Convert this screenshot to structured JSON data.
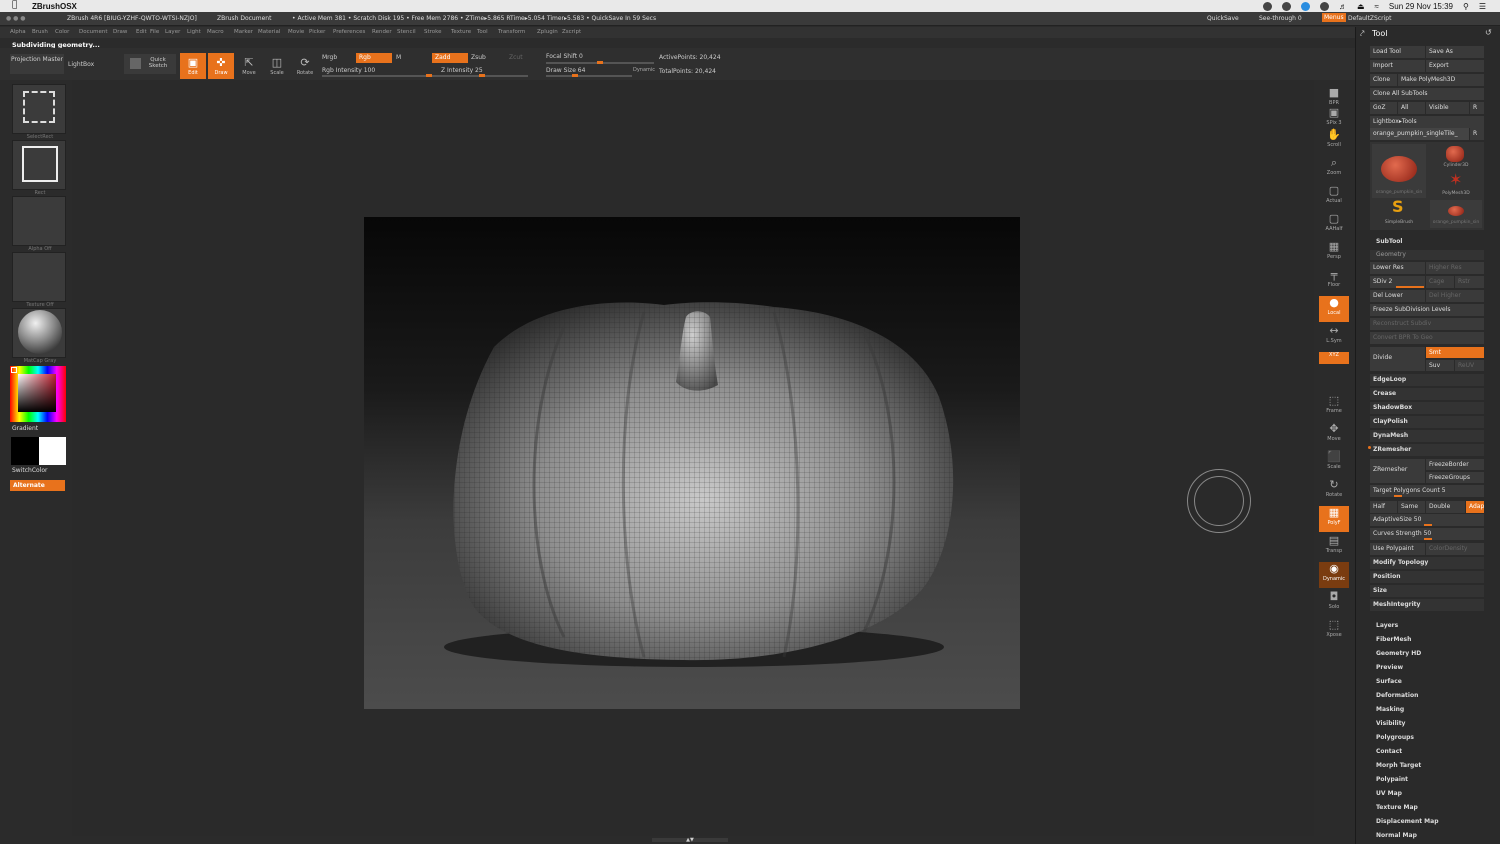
{
  "macos": {
    "app_name": "ZBrushOSX",
    "datetime": "Sun 29 Nov  15:39"
  },
  "titlebar": {
    "app_version": "ZBrush 4R6 [BIUG-YZHF-QWTO-WTSI-NZJO]",
    "doc_title": "ZBrush Document",
    "mem_info": "• Active Mem 381 • Scratch Disk 195 • Free Mem 2786 • ZTime▸5.865 RTime▸5.054 Timer▸5.583 • QuickSave In 59 Secs",
    "quicksave": "QuickSave",
    "seethrough": "See-through  0",
    "menus": "Menus",
    "defaultscript": "DefaultZScript"
  },
  "menubar": [
    "Alpha",
    "Brush",
    "Color",
    "Document",
    "Draw",
    "Edit",
    "File",
    "Layer",
    "Light",
    "Macro",
    "Marker",
    "Material",
    "Movie",
    "Picker",
    "Preferences",
    "Render",
    "Stencil",
    "Stroke",
    "Texture",
    "Tool",
    "Transform",
    "Zplugin",
    "Zscript"
  ],
  "status_message": "Subdividing geometry...",
  "shelf": {
    "projection_master": "Projection Master",
    "lightbox": "LightBox",
    "quick_sketch": "Quick Sketch",
    "edit": "Edit",
    "draw": "Draw",
    "move": "Move",
    "scale": "Scale",
    "rotate": "Rotate",
    "mrgb": "Mrgb",
    "rgb": "Rgb",
    "m": "M",
    "rgb_intensity": "Rgb Intensity 100",
    "zadd": "Zadd",
    "zsub": "Zsub",
    "zcut": "Zcut",
    "z_intensity": "Z Intensity 25",
    "focal_shift": "Focal Shift 0",
    "draw_size": "Draw Size 64",
    "dynamic": "Dynamic",
    "active_points": "ActivePoints: 20,424",
    "total_points": "TotalPoints: 20,424",
    "rgb_intensity_value": 100,
    "z_intensity_value": 25,
    "focal_shift_value": 0,
    "draw_size_value": 64
  },
  "leftshelf": {
    "alpha_caption": "SelectRect",
    "stroke_caption": "Rect",
    "alpha_off": "Alpha  Off",
    "texture_off": "Texture  Off",
    "material": "MatCap Gray",
    "gradient": "Gradient",
    "switchcolor": "SwitchColor",
    "alternate": "Alternate"
  },
  "rightbar": [
    {
      "label": "BPR",
      "icon": "render-icon"
    },
    {
      "label": "SPix 3",
      "icon": "spix-icon"
    },
    {
      "label": "Scroll",
      "icon": "scroll-icon"
    },
    {
      "label": "Zoom",
      "icon": "zoom-icon"
    },
    {
      "label": "Actual",
      "icon": "actual-icon"
    },
    {
      "label": "AAHalf",
      "icon": "aahalf-icon"
    },
    {
      "label": "Persp",
      "icon": "persp-icon"
    },
    {
      "label": "Floor",
      "icon": "floor-icon"
    },
    {
      "label": "Local",
      "icon": "local-icon"
    },
    {
      "label": "L.Sym",
      "icon": "lsym-icon"
    },
    {
      "label": "XYZ",
      "icon": "xyz-icon"
    },
    {
      "label": "Frame",
      "icon": "frame-icon"
    },
    {
      "label": "Move",
      "icon": "move-icon"
    },
    {
      "label": "Scale",
      "icon": "scale-icon"
    },
    {
      "label": "Rotate",
      "icon": "rotate-icon"
    },
    {
      "label": "PolyF",
      "icon": "polyf-icon"
    },
    {
      "label": "Transp",
      "icon": "transp-icon"
    },
    {
      "label": "Dynamic",
      "icon": "dynamic-icon"
    },
    {
      "label": "Solo",
      "icon": "solo-icon"
    },
    {
      "label": "Xpose",
      "icon": "xpose-icon"
    }
  ],
  "palette": {
    "title": "Tool",
    "load_tool": "Load Tool",
    "save_as": "Save As",
    "import": "Import",
    "export": "Export",
    "clone": "Clone",
    "make_polymesh": "Make PolyMesh3D",
    "clone_all": "Clone  All SubTools",
    "goz": "GoZ",
    "all": "All",
    "visible": "Visible",
    "r": "R",
    "lightbox_tools": "Lightbox▸Tools",
    "current_tool": "orange_pumpkin_singleTile_",
    "tools": [
      {
        "name": "orange_pumpkin_sin"
      },
      {
        "name": "Cylinder3D"
      },
      {
        "name": "PolyMesh3D"
      },
      {
        "name": "SimpleBrush"
      },
      {
        "name": "orange_pumpkin_sin"
      }
    ],
    "subtool": "SubTool",
    "geometry": "Geometry",
    "lower_res": "Lower Res",
    "higher_res": "Higher Res",
    "sdiv": "SDiv 2",
    "cage": "Cage",
    "rstr": "Rstr",
    "del_lower": "Del Lower",
    "del_higher": "Del Higher",
    "freeze_sub": "Freeze SubDivision Levels",
    "reconstruct": "Reconstruct Subdiv",
    "convert_bpr": "Convert BPR To Geo",
    "divide": "Divide",
    "smt": "Smt",
    "suv": "Suv",
    "reuv": "ReUV",
    "edgeloop": "EdgeLoop",
    "crease": "Crease",
    "shadowbox": "ShadowBox",
    "claypolish": "ClayPolish",
    "dynamesh": "DynaMesh",
    "zremesher_title": "ZRemesher",
    "zremesher": "ZRemesher",
    "freezeborder": "FreezeBorder",
    "freezegroups": "FreezeGroups",
    "target_polys": "Target Polygons Count 5",
    "half": "Half",
    "same": "Same",
    "double": "Double",
    "adapt": "Adapt",
    "adaptive_size": "AdaptiveSize 50",
    "curves_strength": "Curves Strength 50",
    "use_polypaint": "Use Polypaint",
    "color_density": "ColorDensity",
    "modify_topology": "Modify Topology",
    "position": "Position",
    "size": "Size",
    "meshintegrity": "MeshIntegrity",
    "sections": [
      "Layers",
      "FiberMesh",
      "Geometry HD",
      "Preview",
      "Surface",
      "Deformation",
      "Masking",
      "Visibility",
      "Polygroups",
      "Contact",
      "Morph Target",
      "Polypaint",
      "UV Map",
      "Texture Map",
      "Displacement Map",
      "Normal Map"
    ]
  },
  "colors": {
    "accent": "#e8721c",
    "panel": "#2a2a2a",
    "canvas_dark": "#070707",
    "canvas_light": "#4c4c4c"
  }
}
